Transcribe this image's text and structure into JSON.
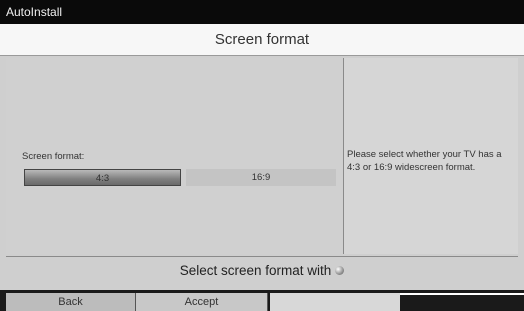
{
  "window": {
    "title": "AutoInstall"
  },
  "header": {
    "title": "Screen format"
  },
  "form": {
    "field_label": "Screen format:",
    "options": [
      {
        "label": "4:3",
        "selected": true
      },
      {
        "label": "16:9",
        "selected": false
      }
    ]
  },
  "help": {
    "text": "Please select whether your TV has a 4:3 or 16:9 widescreen format."
  },
  "status": {
    "text": "Select screen format with"
  },
  "footer": {
    "buttons": [
      {
        "label": "Back"
      },
      {
        "label": "Accept"
      },
      {
        "label": ""
      },
      {
        "label": ""
      }
    ]
  },
  "icons": {
    "status_icon": "round-button-icon"
  }
}
